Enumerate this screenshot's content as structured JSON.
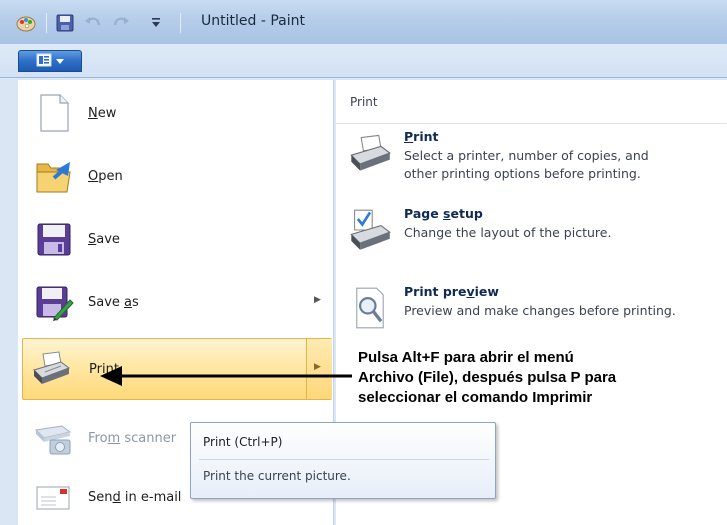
{
  "window": {
    "title": "Untitled - Paint"
  },
  "quick_access": [
    {
      "icon": "paint-app-icon"
    },
    {
      "icon": "save-icon"
    },
    {
      "icon": "undo-icon"
    },
    {
      "icon": "redo-icon"
    },
    {
      "icon": "customize-dropdown-icon"
    }
  ],
  "app_menu_button": {
    "icon": "paint-menu-icon"
  },
  "menu": {
    "items": [
      {
        "pre": "",
        "key": "N",
        "post": "ew",
        "icon": "new-document-icon",
        "submenu": false,
        "state": "normal"
      },
      {
        "pre": "",
        "key": "O",
        "post": "pen",
        "icon": "open-folder-icon",
        "submenu": false,
        "state": "normal"
      },
      {
        "pre": "",
        "key": "S",
        "post": "ave",
        "icon": "save-disk-icon",
        "submenu": false,
        "state": "normal"
      },
      {
        "pre": "Save ",
        "key": "a",
        "post": "s",
        "icon": "save-as-icon",
        "submenu": true,
        "state": "normal"
      },
      {
        "pre": "Prin",
        "key": "t",
        "post": "",
        "icon": "printer-icon",
        "submenu": true,
        "state": "highlighted"
      },
      {
        "pre": "Fro",
        "key": "m",
        "post": " scanner",
        "icon": "scanner-camera-icon",
        "submenu": false,
        "state": "disabled"
      },
      {
        "pre": "Sen",
        "key": "d",
        "post": " in e-mail",
        "icon": "email-icon",
        "submenu": false,
        "state": "normal"
      }
    ]
  },
  "print_panel": {
    "header": "Print",
    "options": [
      {
        "title_pre": "",
        "title_key": "P",
        "title_post": "rint",
        "desc_line1": "Select a printer, number of copies, and",
        "desc_line2": "other printing options before printing.",
        "icon": "printer-icon"
      },
      {
        "title_pre": "Page ",
        "title_key": "s",
        "title_post": "etup",
        "desc_line1": "Change the layout of the picture.",
        "desc_line2": "",
        "icon": "page-setup-icon"
      },
      {
        "title_pre": "Print pre",
        "title_key": "v",
        "title_post": "iew",
        "desc_line1": "Preview and make changes before printing.",
        "desc_line2": "",
        "icon": "print-preview-icon"
      }
    ]
  },
  "tooltip": {
    "title": "Print (Ctrl+P)",
    "description": "Print the current picture."
  },
  "annotation": {
    "line1": "Pulsa Alt+F para abrir el menú",
    "line2": "Archivo (File), después pulsa P para",
    "line3": "seleccionar el comando Imprimir"
  },
  "colors": {
    "titlebar": "#b5cdea",
    "menu_button": "#2f6fc6",
    "highlight": "#ffe6a0",
    "highlight_border": "#e2b44e",
    "disabled_text": "#8d96a3",
    "annotation_text": "#000000"
  }
}
